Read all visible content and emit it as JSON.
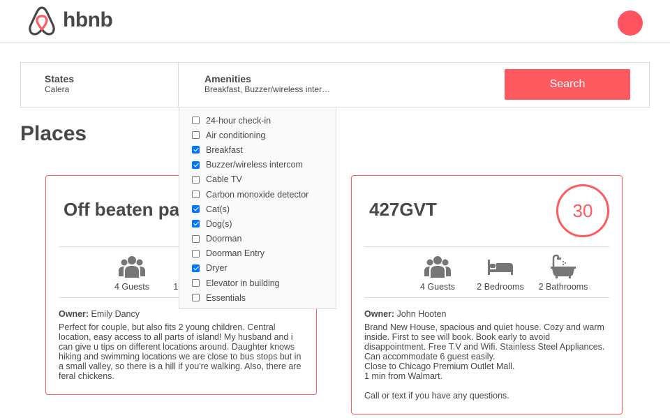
{
  "header": {
    "logo_text": "hbnb",
    "brand_color": "#ff5a5f",
    "api_status_color": "#ff545f"
  },
  "filters": {
    "states": {
      "title": "States",
      "value": "Calera"
    },
    "amenities": {
      "title": "Amenities",
      "value": "Breakfast, Buzzer/wireless inter…",
      "options": [
        {
          "label": "24-hour check-in",
          "checked": false
        },
        {
          "label": "Air conditioning",
          "checked": false
        },
        {
          "label": "Breakfast",
          "checked": true
        },
        {
          "label": "Buzzer/wireless intercom",
          "checked": true
        },
        {
          "label": "Cable TV",
          "checked": false
        },
        {
          "label": "Carbon monoxide detector",
          "checked": false
        },
        {
          "label": "Cat(s)",
          "checked": true
        },
        {
          "label": "Dog(s)",
          "checked": true
        },
        {
          "label": "Doorman",
          "checked": false
        },
        {
          "label": "Doorman Entry",
          "checked": false
        },
        {
          "label": "Dryer",
          "checked": true
        },
        {
          "label": "Elevator in building",
          "checked": false
        },
        {
          "label": "Essentials",
          "checked": false
        }
      ]
    },
    "search_label": "Search"
  },
  "places_title": "Places",
  "places": [
    {
      "name": "Off beaten path",
      "price": "",
      "guests": "4 Guests",
      "bedrooms": "1 Bedroom",
      "bathrooms": "",
      "owner_label": "Owner:",
      "owner_name": "Emily Dancy",
      "description": "Perfect for couple, but also fits 2 young children. Central location, easy access to all parts of island! My husband and i can give u tips on different locations around. Daughter knows hiking and swimming locations we are close to bus stops but in a small valley, so there is a hill if you're walking. Also, there are feral chickens."
    },
    {
      "name": "427GVT",
      "price": "30",
      "guests": "4 Guests",
      "bedrooms": "2 Bedrooms",
      "bathrooms": "2 Bathrooms",
      "owner_label": "Owner:",
      "owner_name": "John Hooten",
      "description": "Brand New House, spacious and quiet house. Cozy and warm inside. First to see will book. Book early to avoid disappointment. Free T.V and Wifi. Stainless Steel Appliances.\nCan accommodate 6 guest easily.\nClose to Chicago Premium Outlet Mall.\n1 min from Walmart.\n\nCall or text if you have any questions."
    }
  ]
}
